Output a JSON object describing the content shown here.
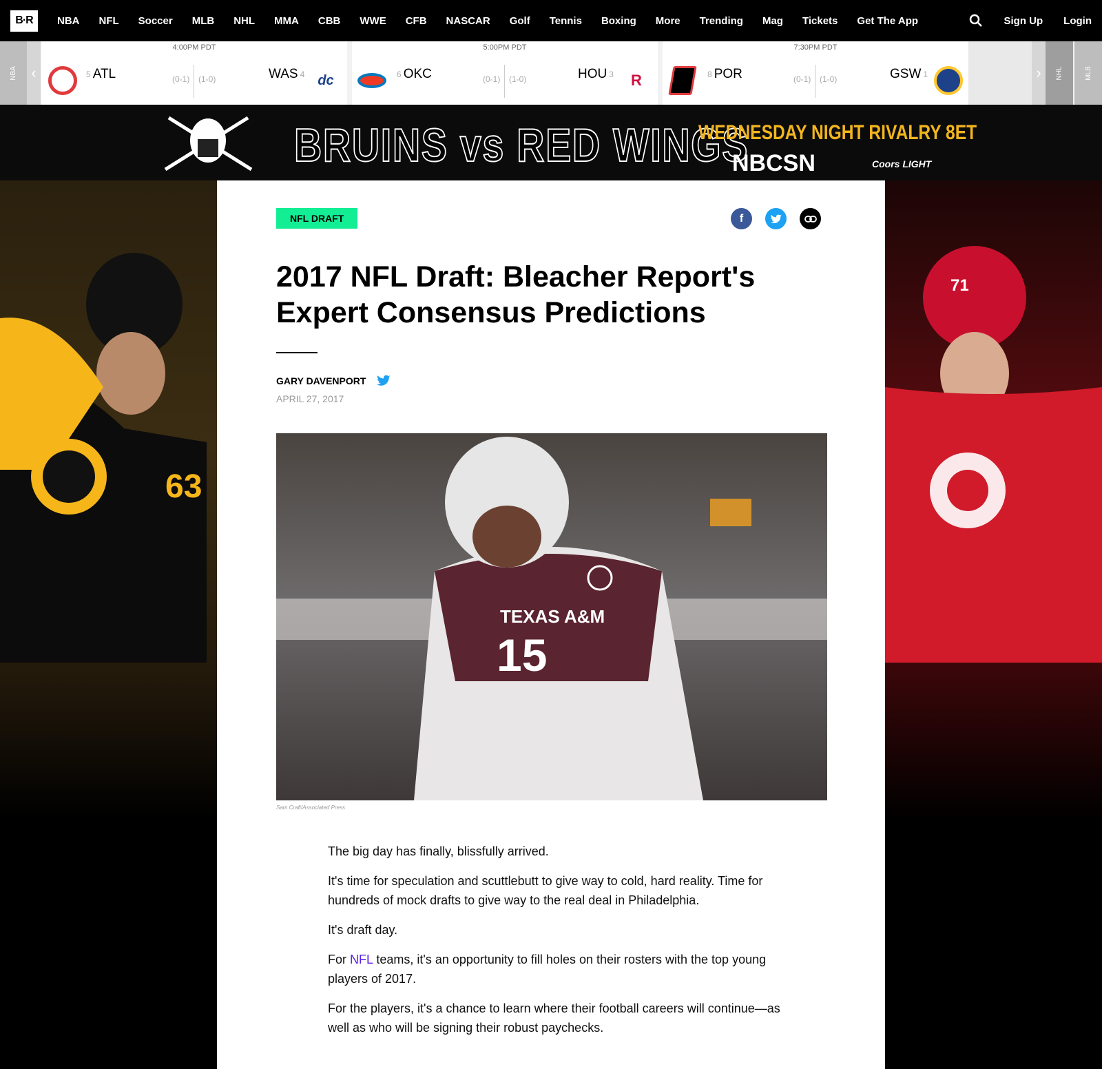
{
  "nav": {
    "logo": "B·R",
    "links": [
      "NBA",
      "NFL",
      "Soccer",
      "MLB",
      "NHL",
      "MMA",
      "CBB",
      "WWE",
      "CFB",
      "NASCAR",
      "Golf",
      "Tennis",
      "Boxing",
      "More",
      "Trending",
      "Mag",
      "Tickets",
      "Get The App"
    ],
    "signup": "Sign Up",
    "login": "Login"
  },
  "scoreboard": {
    "left_tab": "NBA",
    "right_tabs": [
      "NHL",
      "MLB"
    ],
    "games": [
      {
        "time": "4:00PM PDT",
        "home_seed": "5",
        "home": "ATL",
        "home_rec": "(0-1)",
        "away_rec": "(1-0)",
        "away": "WAS",
        "away_seed": "4",
        "home_color": "#e03a3e",
        "away_color": "#ffffff"
      },
      {
        "time": "5:00PM PDT",
        "home_seed": "6",
        "home": "OKC",
        "home_rec": "(0-1)",
        "away_rec": "(1-0)",
        "away": "HOU",
        "away_seed": "3",
        "home_color": "#ffffff",
        "away_color": "#ffffff"
      },
      {
        "time": "7:30PM PDT",
        "home_seed": "8",
        "home": "POR",
        "home_rec": "(0-1)",
        "away_rec": "(1-0)",
        "away": "GSW",
        "away_seed": "1",
        "home_color": "#ffffff",
        "away_color": "#1d428a"
      }
    ]
  },
  "banner": {
    "title": "BRUINS vs RED WINGS",
    "subtitle": "WEDNESDAY NIGHT RIVALRY 8ET",
    "network": "NBCSN",
    "sponsor": "Coors LIGHT"
  },
  "article": {
    "tag": "NFL DRAFT",
    "headline": "2017 NFL Draft: Bleacher Report's Expert Consensus Predictions",
    "author": "GARY DAVENPORT",
    "date": "APRIL 27, 2017",
    "caption": "Sam Craft/Associated Press",
    "paragraphs": [
      "The big day has finally, blissfully arrived.",
      "It's time for speculation and scuttlebutt to give way to cold, hard reality. Time for hundreds of mock drafts to give way to the real deal in Philadelphia.",
      "It's draft day.",
      "For",
      "NFL",
      "teams, it's an opportunity to fill holes on their rosters with the top young players of 2017.",
      "For the players, it's a chance to learn where their football careers will continue—as well as who will be signing their robust paychecks."
    ],
    "photo_jersey_school": "TEXAS A&M",
    "photo_jersey_number": "15"
  },
  "colors": {
    "tag": "#13ee95",
    "facebook": "#3b5998",
    "twitter": "#1da1f2",
    "link": "#5a1fe8"
  }
}
